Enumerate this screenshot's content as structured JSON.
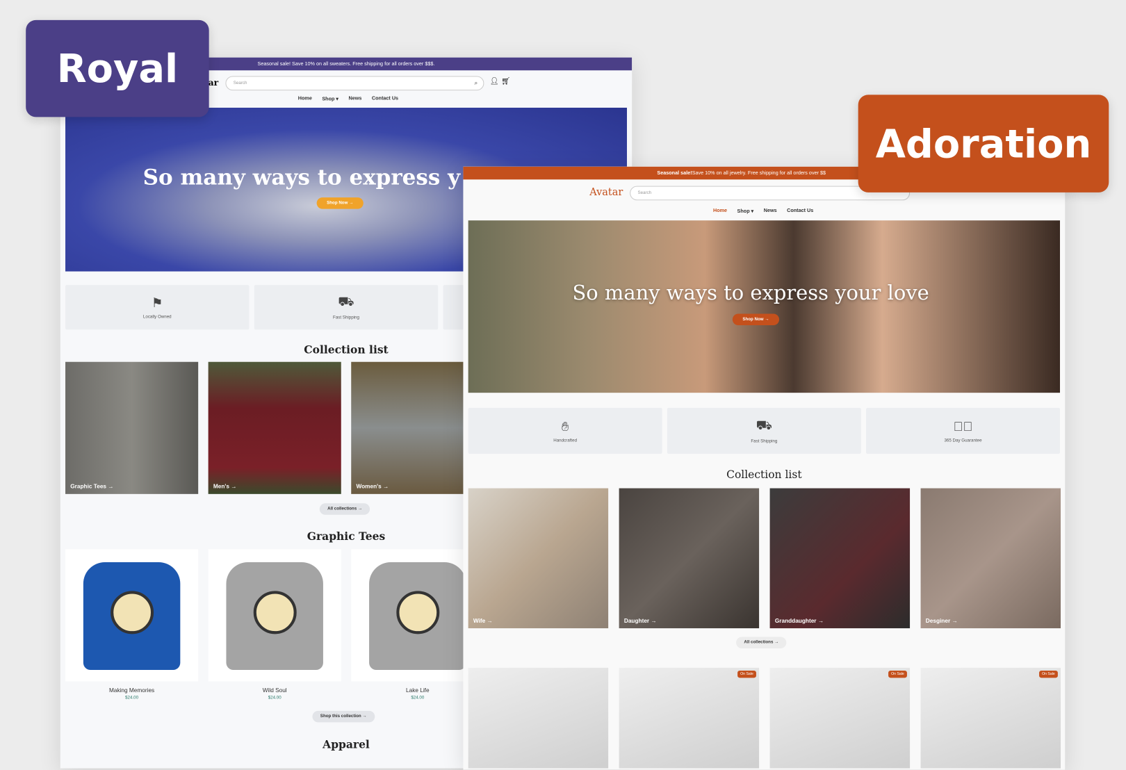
{
  "labels": {
    "royal": "Royal",
    "adoration": "Adoration"
  },
  "colors": {
    "royal": "#4b3f87",
    "adoration": "#c4501c",
    "royal_button": "#f0a32a"
  },
  "royal": {
    "announcement": "Seasonal sale! Save 10% on all sweaters. Free shipping for all orders over $$$.",
    "logo_partial": "ar",
    "search_placeholder": "Search",
    "nav": [
      "Home",
      "Shop",
      "News",
      "Contact Us"
    ],
    "hero_title": "So many ways to express y",
    "hero_button": "Shop Now →",
    "features": [
      "Locally Owned",
      "Fast Shipping"
    ],
    "collection_title": "Collection list",
    "collections": [
      "Graphic Tees →",
      "Men's →",
      "Women's →"
    ],
    "all_collections": "All collections →",
    "featured_title": "Graphic Tees",
    "products": [
      {
        "name": "Making Memories",
        "price": "$24.00"
      },
      {
        "name": "Wild Soul",
        "price": "$24.00"
      },
      {
        "name": "Lake Life",
        "price": "$24.00"
      }
    ],
    "shop_collection": "Shop this collection →",
    "apparel_title": "Apparel"
  },
  "adoration": {
    "announcement_bold": "Seasonal sale!",
    "announcement": " Save 10% on all jewelry. Free shipping for all orders over $$",
    "logo": "Avatar",
    "search_placeholder": "Search",
    "nav": [
      "Home",
      "Shop",
      "News",
      "Contact Us"
    ],
    "hero_title": "So many ways to express your love",
    "hero_button": "Shop Now →",
    "features": [
      "Handcrafted",
      "Fast Shipping",
      "365 Day Guarantee"
    ],
    "collection_title": "Collection list",
    "collections": [
      "Wife →",
      "Daughter →",
      "Granddaughter →",
      "Desginer →"
    ],
    "all_collections": "All collections →",
    "on_sale": "On Sale"
  }
}
